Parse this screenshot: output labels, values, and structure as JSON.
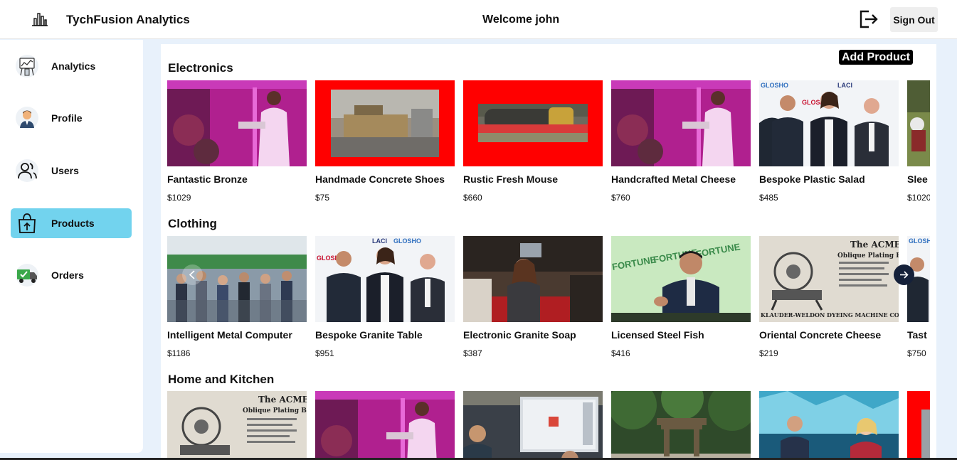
{
  "header": {
    "logo_icon": "bar-chart-icon",
    "brand": "TychFusion Analytics",
    "welcome": "Welcome john",
    "signout_icon": "logout-icon",
    "signout_label": "Sign Out"
  },
  "sidebar": {
    "items": [
      {
        "label": "Analytics",
        "icon": "analytics-icon",
        "active": false
      },
      {
        "label": "Profile",
        "icon": "profile-avatar-icon",
        "active": false
      },
      {
        "label": "Users",
        "icon": "users-icon",
        "active": false
      },
      {
        "label": "Products",
        "icon": "shopping-bag-icon",
        "active": true
      },
      {
        "label": "Orders",
        "icon": "delivery-truck-icon",
        "active": false
      }
    ],
    "active_color": "#72d3ee"
  },
  "main": {
    "add_product_label": "Add Product",
    "categories": [
      {
        "title": "Electronics",
        "products": [
          {
            "name": "Fantastic Bronze",
            "price": "$1029",
            "image": "lab-pink-photo"
          },
          {
            "name": "Handmade Concrete Shoes",
            "price": "$75",
            "image": "machine-red-frame-photo"
          },
          {
            "name": "Rustic Fresh Mouse",
            "price": "$660",
            "image": "roller-red-frame-photo"
          },
          {
            "name": "Handcrafted Metal Cheese",
            "price": "$760",
            "image": "lab-pink-photo"
          },
          {
            "name": "Bespoke Plastic Salad",
            "price": "$485",
            "image": "people-event-photo"
          },
          {
            "name": "Slee",
            "price": "$1020",
            "image": "sports-photo"
          }
        ]
      },
      {
        "title": "Clothing",
        "products": [
          {
            "name": "Intelligent Metal Computer",
            "price": "$1186",
            "image": "crowd-photo"
          },
          {
            "name": "Bespoke Granite Table",
            "price": "$951",
            "image": "people-event-photo"
          },
          {
            "name": "Electronic Granite Soap",
            "price": "$387",
            "image": "conference-photo"
          },
          {
            "name": "Licensed Steel Fish",
            "price": "$416",
            "image": "speaker-photo"
          },
          {
            "name": "Oriental Concrete Cheese",
            "price": "$219",
            "image": "vintage-ad-photo"
          },
          {
            "name": "Tast",
            "price": "$750",
            "image": "people-event-photo"
          }
        ]
      },
      {
        "title": "Home and Kitchen",
        "products": [
          {
            "name": "",
            "price": "",
            "image": "vintage-ad-photo"
          },
          {
            "name": "",
            "price": "",
            "image": "lab-pink-photo"
          },
          {
            "name": "",
            "price": "",
            "image": "office-photo"
          },
          {
            "name": "",
            "price": "",
            "image": "temple-photo"
          },
          {
            "name": "",
            "price": "",
            "image": "stage-photo"
          },
          {
            "name": "",
            "price": "",
            "image": "red-frame-photo"
          }
        ]
      }
    ],
    "vintage_ad_text": [
      "The ACME",
      "Oblique Plating Barrel",
      "KLAUDER-WELDON DYEING MACHINE CO."
    ],
    "banner_text": [
      "LACI",
      "GLOSHO"
    ],
    "sign_text": "FORTUNE"
  },
  "colors": {
    "page_bg": "#e8f1fb",
    "arrow_bg": "#15213a",
    "frame_red": "#ff0000",
    "lab_pink": "#e030d0"
  }
}
